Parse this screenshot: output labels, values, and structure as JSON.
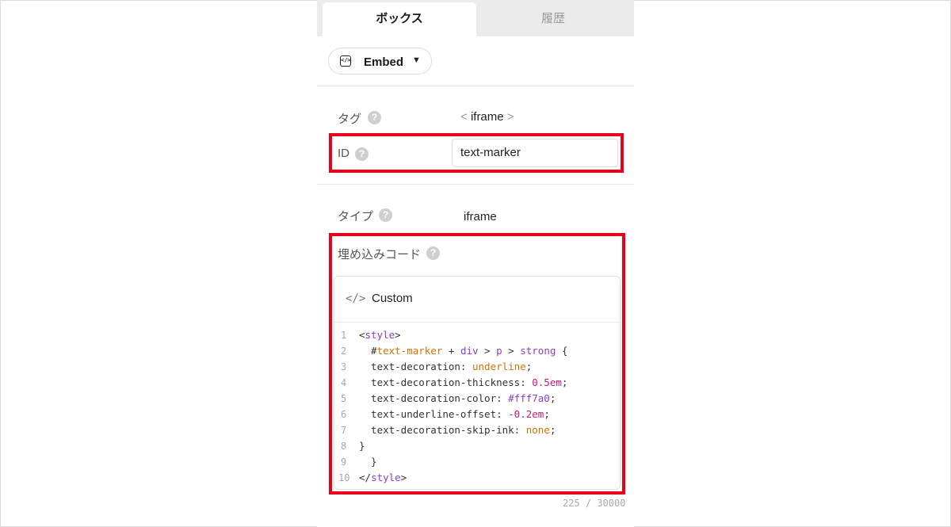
{
  "tabs": [
    {
      "label": "ボックス",
      "active": true
    },
    {
      "label": "履歴",
      "active": false
    }
  ],
  "embed_button": {
    "label": "Embed",
    "icon": "code-icon"
  },
  "fields": {
    "tag": {
      "label": "タグ",
      "value_open": "<",
      "value": "iframe",
      "value_close": ">"
    },
    "id": {
      "label": "ID",
      "value": "text-marker"
    },
    "type": {
      "label": "タイプ",
      "value": "iframe"
    },
    "embed_code": {
      "label": "埋め込みコード"
    }
  },
  "help_glyph": "?",
  "code_editor": {
    "header_icon": "</>",
    "header_title": "Custom",
    "lines": [
      {
        "num": "1",
        "parts": [
          [
            "",
            "<"
          ],
          [
            "purple",
            "style"
          ],
          [
            "",
            ">"
          ]
        ]
      },
      {
        "num": "2",
        "parts": [
          [
            "",
            "  #"
          ],
          [
            "orange",
            "text-marker"
          ],
          [
            "",
            " + "
          ],
          [
            "purple",
            "div"
          ],
          [
            "",
            " > "
          ],
          [
            "purple",
            "p"
          ],
          [
            "",
            " > "
          ],
          [
            "purple",
            "strong"
          ],
          [
            "",
            " {"
          ]
        ]
      },
      {
        "num": "3",
        "parts": [
          [
            "",
            "  text-decoration: "
          ],
          [
            "orange",
            "underline"
          ],
          [
            "",
            ";"
          ]
        ]
      },
      {
        "num": "4",
        "parts": [
          [
            "",
            "  text-decoration-thickness: "
          ],
          [
            "pink",
            "0.5em"
          ],
          [
            "",
            ";"
          ]
        ]
      },
      {
        "num": "5",
        "parts": [
          [
            "",
            "  text-decoration-color: "
          ],
          [
            "purple",
            "#fff7a0"
          ],
          [
            "",
            ";"
          ]
        ]
      },
      {
        "num": "6",
        "parts": [
          [
            "",
            "  text-underline-offset: "
          ],
          [
            "pink",
            "-0.2em"
          ],
          [
            "",
            ";"
          ]
        ]
      },
      {
        "num": "7",
        "parts": [
          [
            "",
            "  text-decoration-skip-ink: "
          ],
          [
            "orange",
            "none"
          ],
          [
            "",
            ";"
          ]
        ]
      },
      {
        "num": "8",
        "parts": [
          [
            "",
            "}"
          ]
        ]
      },
      {
        "num": "9",
        "parts": [
          [
            "",
            "  }"
          ]
        ]
      },
      {
        "num": "10",
        "parts": [
          [
            "",
            "</"
          ],
          [
            "purple",
            "style"
          ],
          [
            "",
            ">"
          ]
        ]
      }
    ]
  },
  "char_count": "225 / 30000",
  "colors": {
    "highlight_border": "#e8001c",
    "keyword_purple": "#8e3cc7",
    "keyword_orange": "#d4720a",
    "number_pink": "#c8197e"
  }
}
